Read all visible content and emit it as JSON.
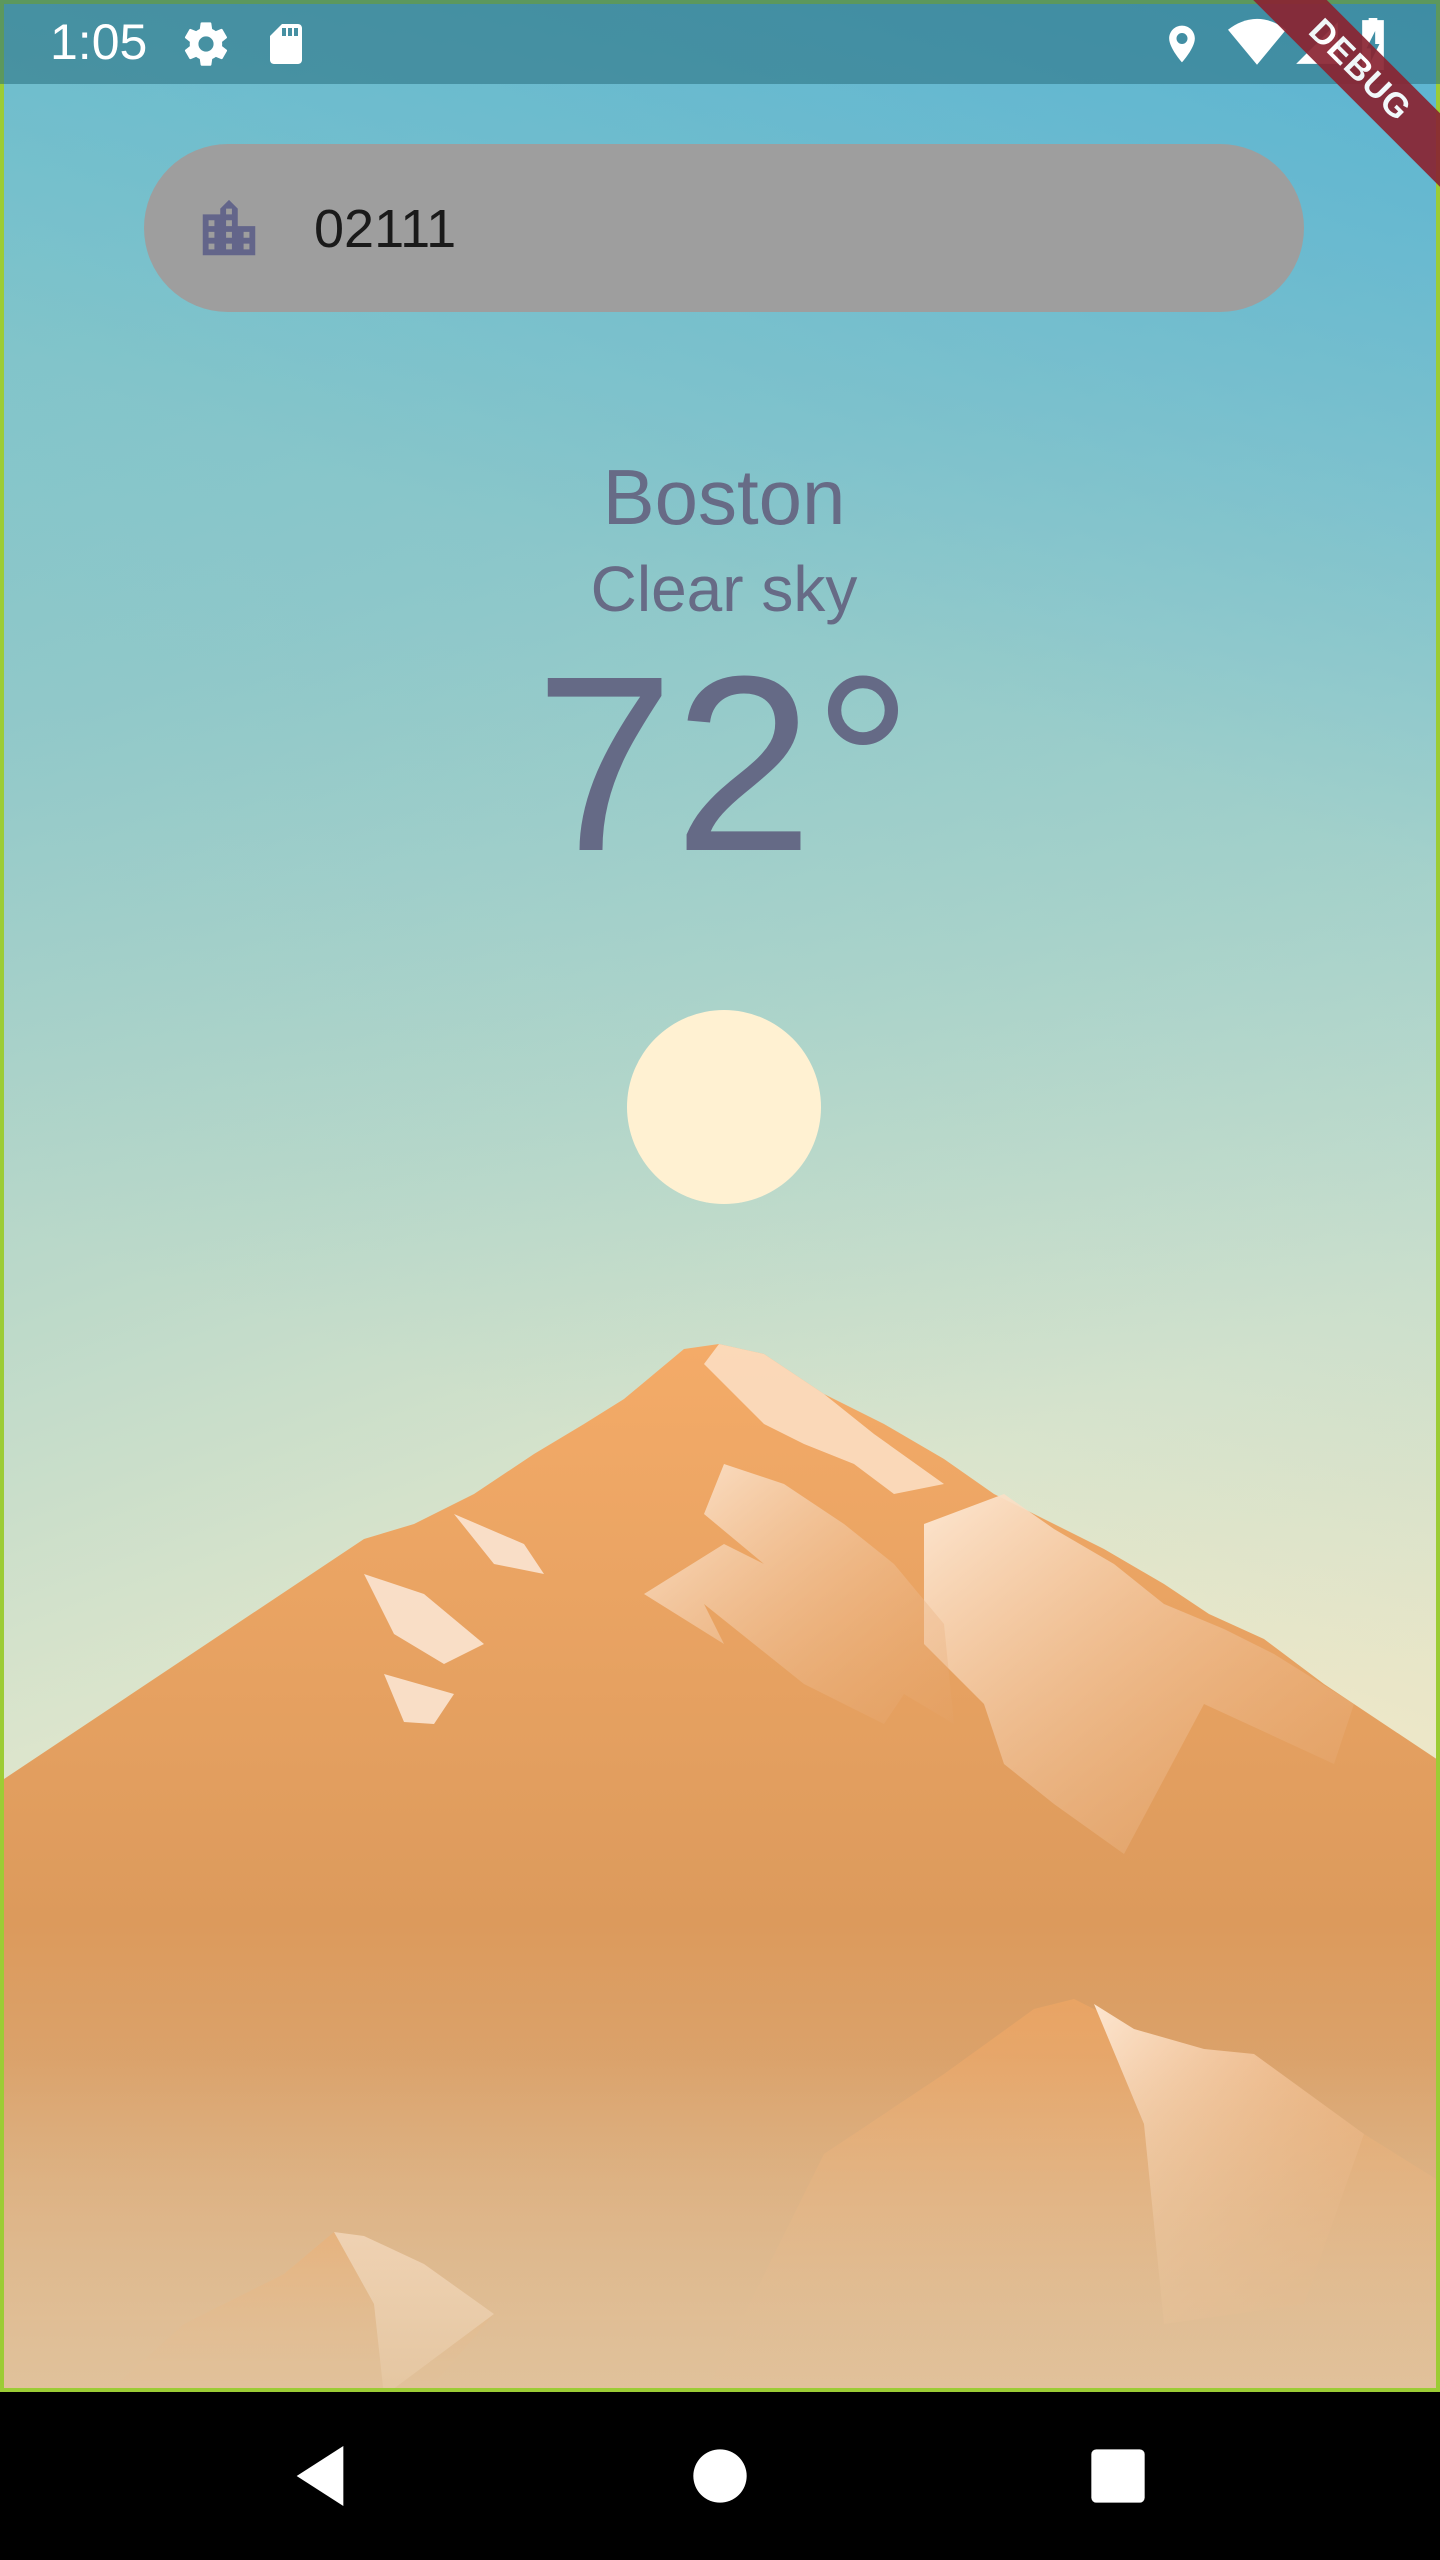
{
  "status_bar": {
    "time": "1:05",
    "left_icons": [
      "gear-icon",
      "sd-card-icon"
    ],
    "right_icons": [
      "location-icon",
      "wifi-icon",
      "signal-icon",
      "battery-charging-icon"
    ]
  },
  "debug_banner": {
    "label": "DEBUG"
  },
  "search": {
    "value": "02111",
    "icon": "city-building-icon"
  },
  "weather": {
    "city": "Boston",
    "condition": "Clear sky",
    "temperature": "72°",
    "icon": "sun-icon"
  },
  "nav": {
    "buttons": [
      "back-icon",
      "home-icon",
      "recents-icon"
    ]
  },
  "colors": {
    "text_primary": "#676b86",
    "pill_bg": "#9e9e9e",
    "sun": "#fff1d2",
    "mountain_base": "#d9955a",
    "debug": "#8a2432"
  }
}
